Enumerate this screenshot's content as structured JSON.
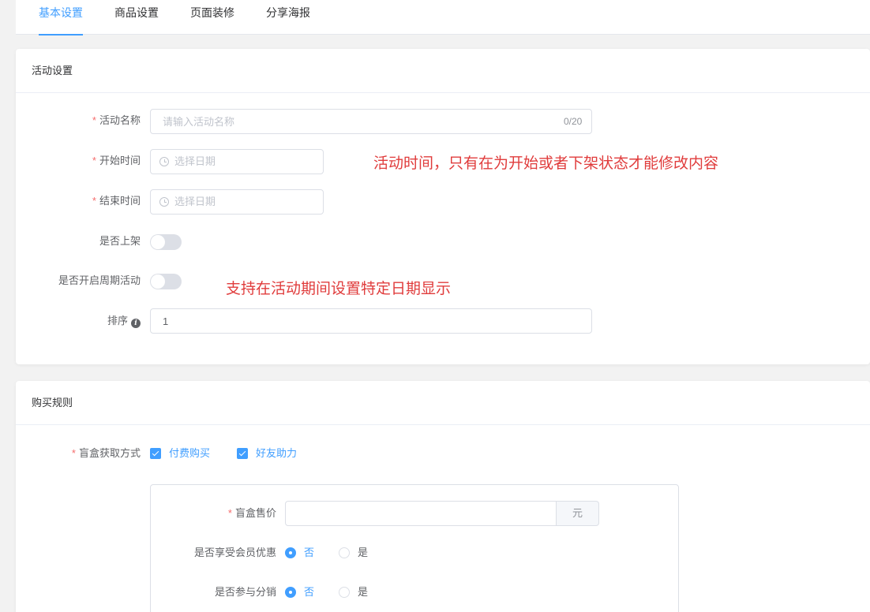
{
  "tabs": [
    {
      "label": "基本设置",
      "active": true
    },
    {
      "label": "商品设置",
      "active": false
    },
    {
      "label": "页面装修",
      "active": false
    },
    {
      "label": "分享海报",
      "active": false
    }
  ],
  "activity_section": {
    "title": "活动设置",
    "name_label": "活动名称",
    "name_placeholder": "请输入活动名称",
    "name_counter": "0/20",
    "start_label": "开始时间",
    "start_placeholder": "选择日期",
    "end_label": "结束时间",
    "end_placeholder": "选择日期",
    "shelf_label": "是否上架",
    "shelf_on": false,
    "cycle_label": "是否开启周期活动",
    "cycle_on": false,
    "sort_label": "排序",
    "sort_value": "1"
  },
  "annotations": {
    "time_note": "活动时间，只有在为开始或者下架状态才能修改内容",
    "cycle_note": "支持在活动期间设置特定日期显示"
  },
  "purchase_section": {
    "title": "购买规则",
    "method_label": "盲盒获取方式",
    "options": [
      {
        "label": "付费购买",
        "checked": true
      },
      {
        "label": "好友助力",
        "checked": true
      }
    ],
    "price_label": "盲盒售价",
    "price_value": "",
    "price_unit": "元",
    "member_label": "是否享受会员优惠",
    "distribution_label": "是否参与分销",
    "radio_no": "否",
    "radio_yes": "是"
  },
  "colors": {
    "accent": "#409eff",
    "required": "#f56c6c",
    "annotation": "#e03c3c"
  }
}
